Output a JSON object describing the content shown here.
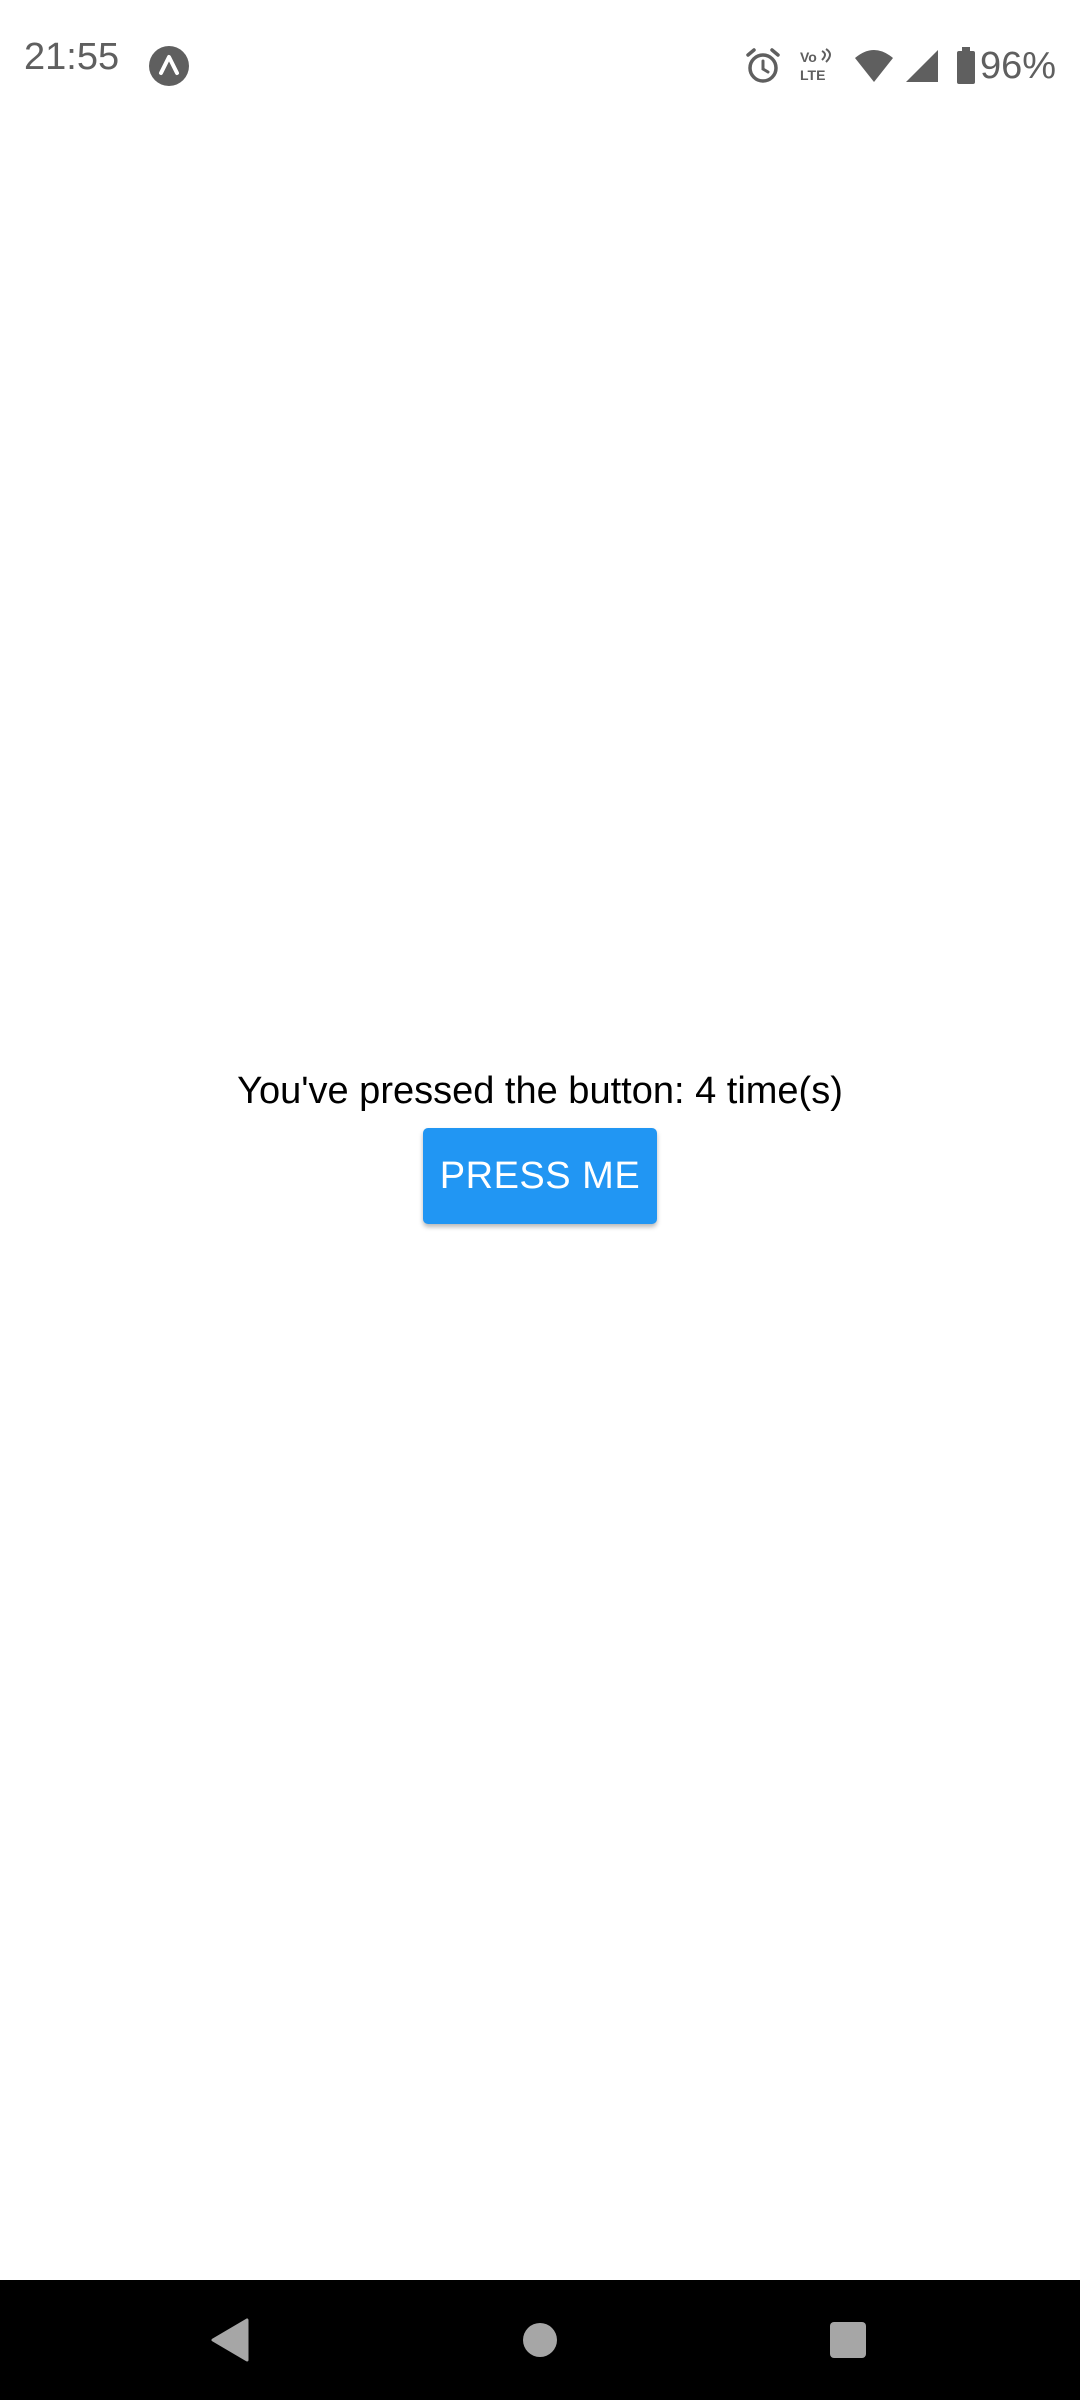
{
  "status_bar": {
    "time": "21:55",
    "app_icon": "app-notification-icon",
    "icons": [
      "alarm-icon",
      "volte-icon",
      "wifi-icon",
      "signal-icon",
      "battery-icon"
    ],
    "battery_percent": "96%"
  },
  "main": {
    "counter_text": "You've pressed the button: 4 time(s)",
    "button_label": "PRESS ME",
    "press_count": 4
  },
  "nav_bar": {
    "items": [
      "back-icon",
      "home-icon",
      "recents-icon"
    ]
  },
  "colors": {
    "button_background": "#2196f3",
    "button_text": "#ffffff",
    "nav_background": "#000000",
    "status_icon": "#5f5f5f"
  }
}
